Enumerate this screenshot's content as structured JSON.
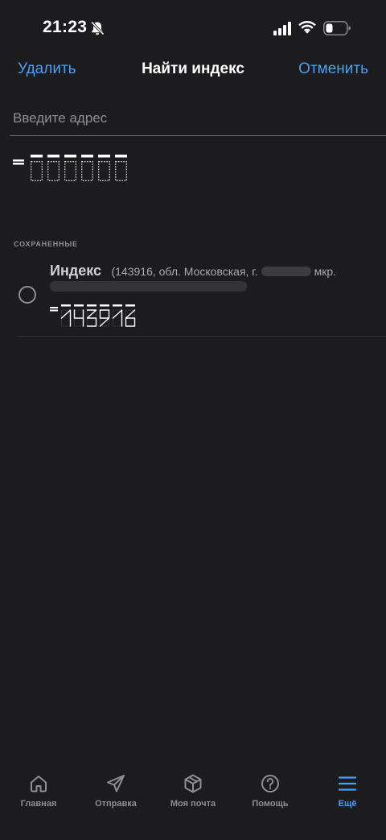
{
  "status_bar": {
    "time": "21:23"
  },
  "nav": {
    "left_action": "Удалить",
    "title": "Найти индекс",
    "right_action": "Отменить"
  },
  "address_input": {
    "placeholder": "Введите адрес",
    "value": ""
  },
  "saved": {
    "section_label": "СОХРАНЕННЫЕ",
    "items": [
      {
        "title": "Индекс",
        "address_prefix": "(143916, обл. Московская, г.",
        "address_suffix": "мкр.",
        "index": "143916"
      }
    ]
  },
  "tabs": [
    {
      "label": "Главная",
      "icon": "home-icon"
    },
    {
      "label": "Отправка",
      "icon": "send-icon"
    },
    {
      "label": "Моя почта",
      "icon": "package-icon"
    },
    {
      "label": "Помощь",
      "icon": "help-icon"
    },
    {
      "label": "Ещё",
      "icon": "menu-icon",
      "active": true
    }
  ],
  "colors": {
    "background": "#1c1c1e",
    "accent": "#4a9ff5",
    "secondary_text": "#8e8e93"
  }
}
